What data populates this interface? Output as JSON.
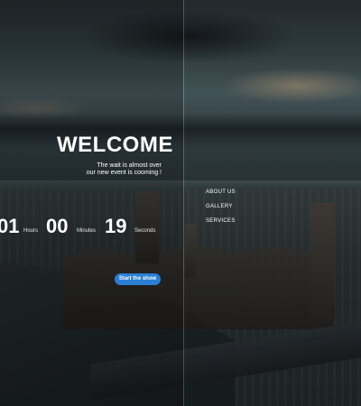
{
  "hero": {
    "title": "WELCOME",
    "tagline_line1": "The wait is almost over",
    "tagline_line2": "our new event is cooming !"
  },
  "countdown": {
    "hours_value": "01",
    "hours_label": "Hours",
    "minutes_value": "00",
    "minutes_label": "Minutes",
    "seconds_value": "19",
    "seconds_label": "Seconds"
  },
  "cta": {
    "label": "Start the show",
    "color": "#2a7fd4"
  },
  "nav": {
    "items": [
      {
        "label": "ABOUT US"
      },
      {
        "label": "GALLERY"
      },
      {
        "label": "SERVICES"
      }
    ]
  }
}
